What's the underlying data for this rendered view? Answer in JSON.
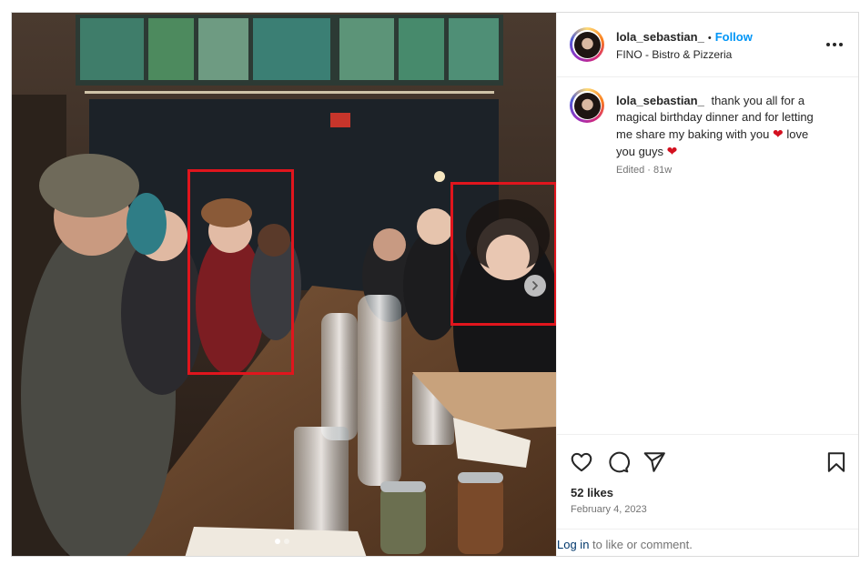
{
  "post": {
    "author": "lola_sebastian_",
    "follow_label": "Follow",
    "separator": "•",
    "location": "FINO - Bistro & Pizzeria",
    "caption_text_1": "thank you all for a magical birthday dinner and for letting me share my baking with you",
    "caption_text_2": "love you guys",
    "heart_glyph": "❤",
    "edited_meta": "Edited · 81w",
    "likes": "52 likes",
    "date": "February 4, 2023",
    "login_link": "Log in",
    "login_rest": " to like or comment."
  },
  "photo": {
    "highlight_color": "#e0151d",
    "carousel_count": 2,
    "carousel_active": 1
  },
  "icons": {
    "more": "more-options-icon",
    "next": "chevron-right-icon",
    "like": "heart-icon",
    "comment": "comment-icon",
    "share": "share-icon",
    "save": "bookmark-icon"
  },
  "colors": {
    "follow": "#0095f6",
    "link": "#00376b",
    "muted": "#737373",
    "text": "#262626"
  }
}
